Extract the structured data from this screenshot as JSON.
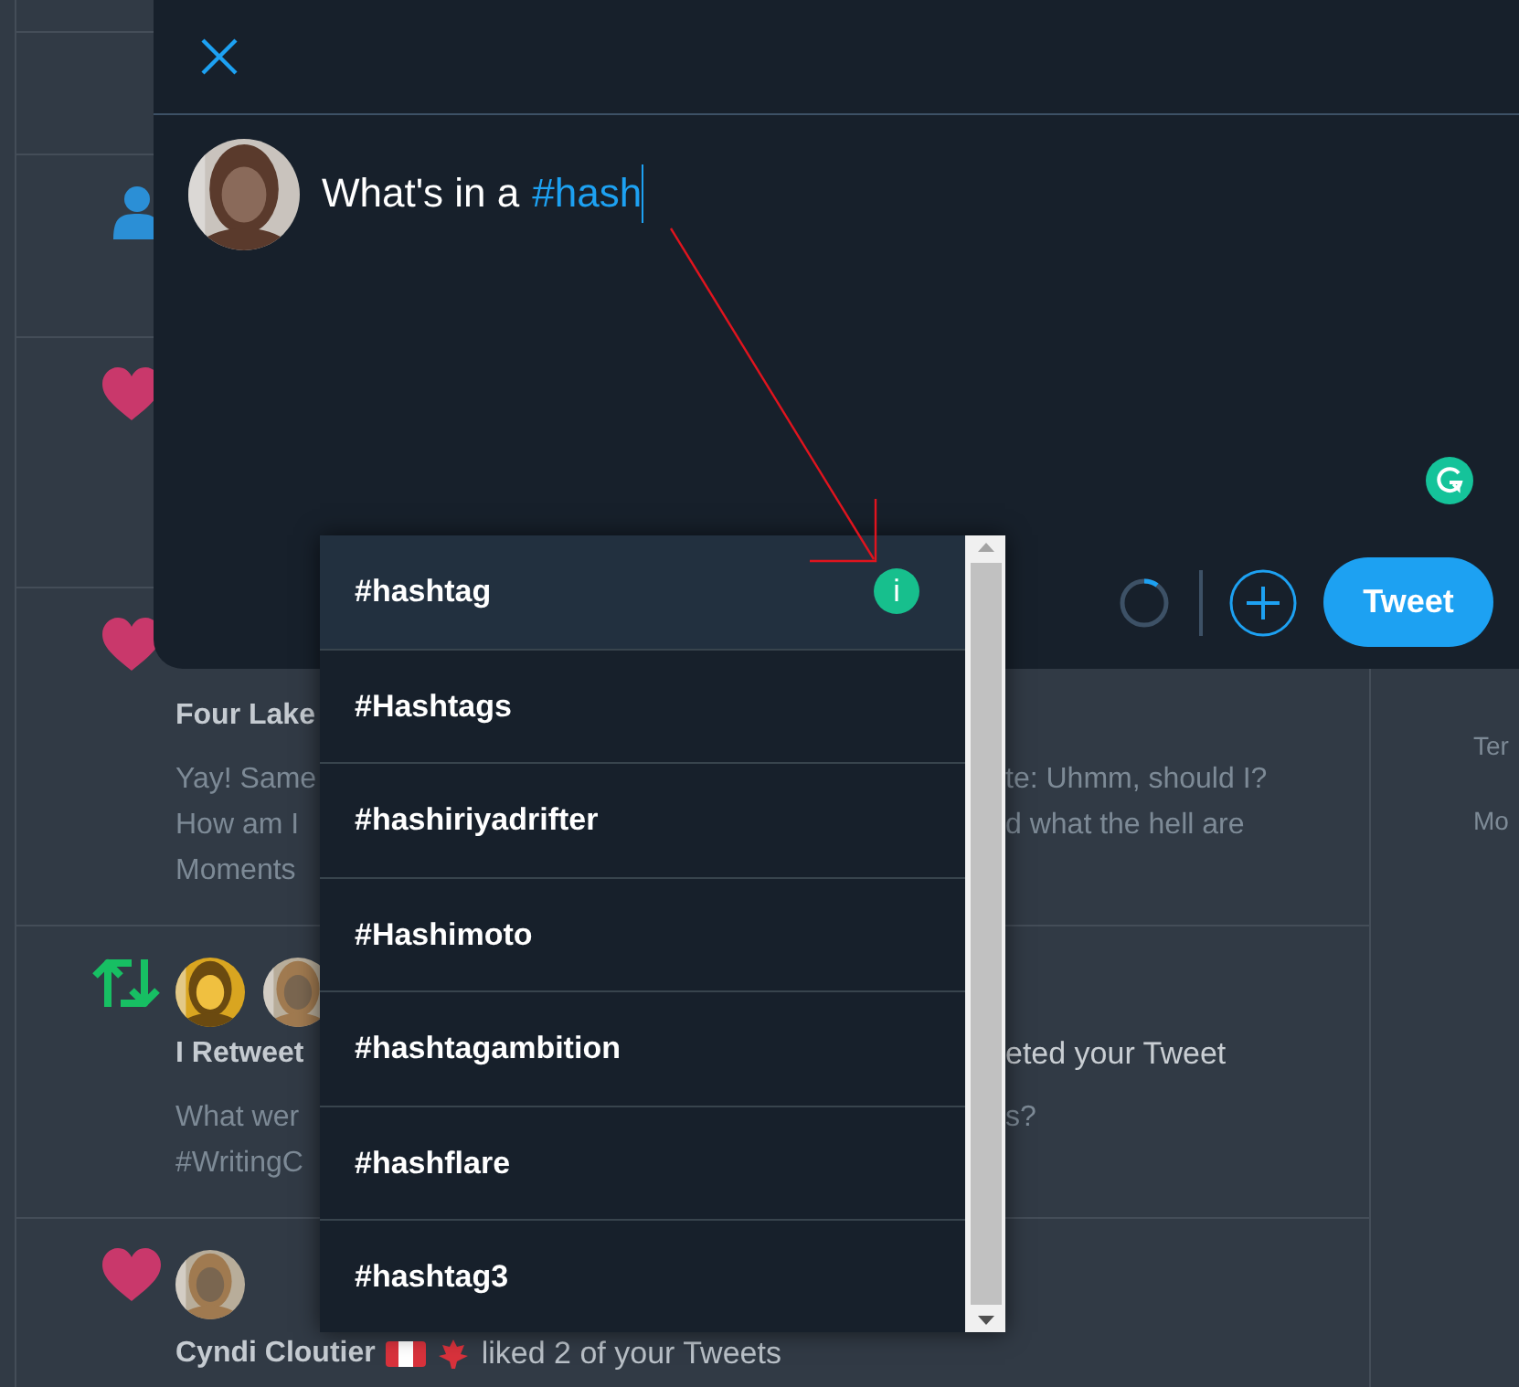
{
  "feed": {
    "rows": [
      {
        "kind": "blank"
      },
      {
        "kind": "blank"
      },
      {
        "kind": "follow"
      },
      {
        "kind": "like"
      },
      {
        "kind": "like",
        "lines": [
          {
            "kind": "title",
            "left": "Four Lake"
          },
          {
            "kind": "body",
            "left": "Yay! Same",
            "right": "te: Uhmm, should I?"
          },
          {
            "kind": "body",
            "left": "How am I",
            "right": "d what the hell are"
          },
          {
            "kind": "body",
            "left": "Moments"
          }
        ]
      },
      {
        "kind": "retweet",
        "avatars": [
          {
            "kind": "picture"
          },
          {
            "kind": "picture"
          }
        ],
        "lines": [
          {
            "kind": "title",
            "left": "I Retweet",
            "right": "eted your Tweet"
          },
          {
            "kind": "body",
            "left": "What wer",
            "right": "s?"
          },
          {
            "kind": "body",
            "left": "#WritingC"
          }
        ]
      },
      {
        "kind": "like",
        "avatars": [
          {
            "kind": "picture"
          }
        ],
        "lines": [
          {
            "kind": "activity",
            "left": "Cyndi Cloutier",
            "right": "liked 2 of your Tweets"
          }
        ]
      }
    ]
  },
  "sidebar": {
    "links": [
      "Ter",
      "Mo"
    ]
  },
  "composer": {
    "text": "What's in a",
    "hashtag": "#hash",
    "tweet_button": "Tweet"
  },
  "suggestions": [
    {
      "label": "#hashtag",
      "selected": true,
      "badge": "i"
    },
    {
      "label": "#Hashtags",
      "selected": false
    },
    {
      "label": "#hashiriyadrifter",
      "selected": false
    },
    {
      "label": "#Hashimoto",
      "selected": false
    },
    {
      "label": "#hashtagambition",
      "selected": false
    },
    {
      "label": "#hashflare",
      "selected": false
    },
    {
      "label": "#hashtag3",
      "selected": false
    }
  ]
}
